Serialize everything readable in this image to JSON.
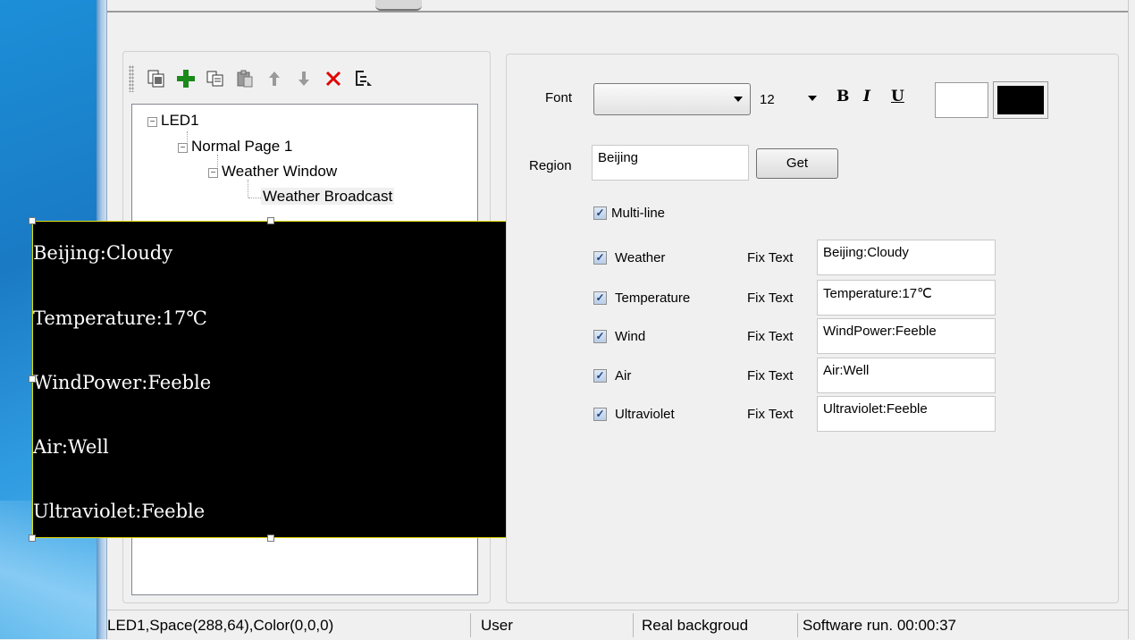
{
  "toolbar": {
    "icons": [
      "copy-page-icon",
      "add-icon",
      "copy-icon",
      "paste-icon",
      "move-up-icon",
      "move-down-icon",
      "delete-icon",
      "tree-expand-icon"
    ],
    "colors": {
      "add": "#1a8a1a",
      "delete": "#e00000",
      "arrow": "#9a9a9a"
    }
  },
  "tree": {
    "root": "LED1",
    "page": "Normal Page 1",
    "window": "Weather Window",
    "item": "Weather Broadcast"
  },
  "preview": {
    "lines": [
      "Beijing:Cloudy",
      "Temperature:17℃",
      "WindPower:Feeble",
      "Air:Well",
      "Ultraviolet:Feeble"
    ],
    "background": "#000000",
    "text_color": "#ffffff"
  },
  "props": {
    "font_label": "Font",
    "font_value": "",
    "font_size": "12",
    "bold_label": "B",
    "italic_label": "I",
    "underline_label": "U",
    "fore_color": "#ffffff",
    "back_color": "#000000",
    "region_label": "Region",
    "region_value": "Beijing",
    "get_label": "Get",
    "multiline_label": "Multi-line",
    "multiline_checked": true,
    "fix_text_label": "Fix Text",
    "rows": [
      {
        "label": "Weather",
        "checked": true,
        "fix_text": "Beijing:Cloudy"
      },
      {
        "label": "Temperature",
        "checked": true,
        "fix_text": "Temperature:17℃"
      },
      {
        "label": "Wind",
        "checked": true,
        "fix_text": "WindPower:Feeble"
      },
      {
        "label": "Air",
        "checked": true,
        "fix_text": "Air:Well"
      },
      {
        "label": "Ultraviolet",
        "checked": true,
        "fix_text": "Ultraviolet:Feeble"
      }
    ]
  },
  "status": {
    "info": "LED1,Space(288,64),Color(0,0,0)",
    "user": "User",
    "background": "Real backgroud",
    "runtime": "Software run. 00:00:37"
  }
}
